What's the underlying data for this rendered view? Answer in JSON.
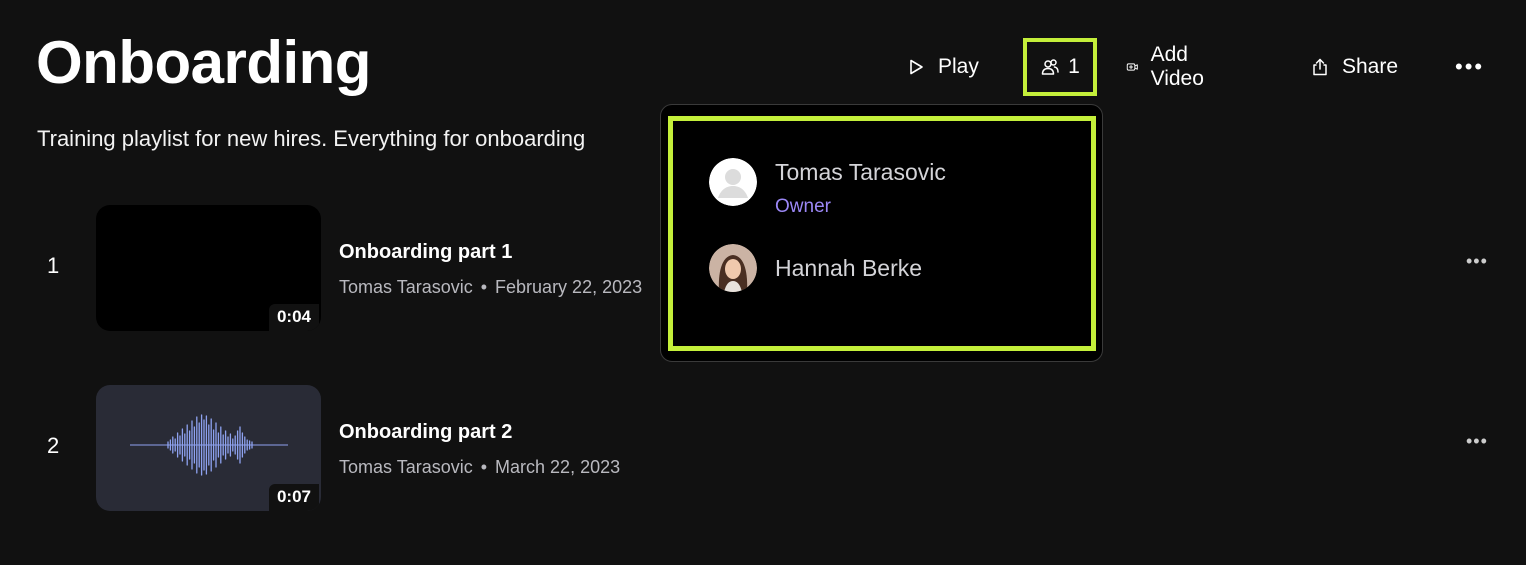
{
  "playlist": {
    "title": "Onboarding",
    "description": "Training playlist for new hires. Everything for onboarding"
  },
  "toolbar": {
    "play_label": "Play",
    "members_count": "1",
    "add_video_label": "Add Video",
    "share_label": "Share",
    "more_label": "•••"
  },
  "videos": [
    {
      "index": "1",
      "title": "Onboarding part 1",
      "author": "Tomas Tarasovic",
      "date": "February 22, 2023",
      "duration": "0:04",
      "thumbnail": "black"
    },
    {
      "index": "2",
      "title": "Onboarding part 2",
      "author": "Tomas Tarasovic",
      "date": "March 22, 2023",
      "duration": "0:07",
      "thumbnail": "audio-waveform"
    }
  ],
  "row_more_label": "•••",
  "meta_separator": "•",
  "members_popover": {
    "members": [
      {
        "name": "Tomas Tarasovic",
        "role": "Owner",
        "avatar": "default-person-icon"
      },
      {
        "name": "Hannah Berke",
        "role": "",
        "avatar": "photo"
      }
    ]
  },
  "colors": {
    "background": "#111111",
    "highlight": "#c4ef3a",
    "role_accent": "#9b87f5",
    "waveform": "#8ea2f0"
  }
}
